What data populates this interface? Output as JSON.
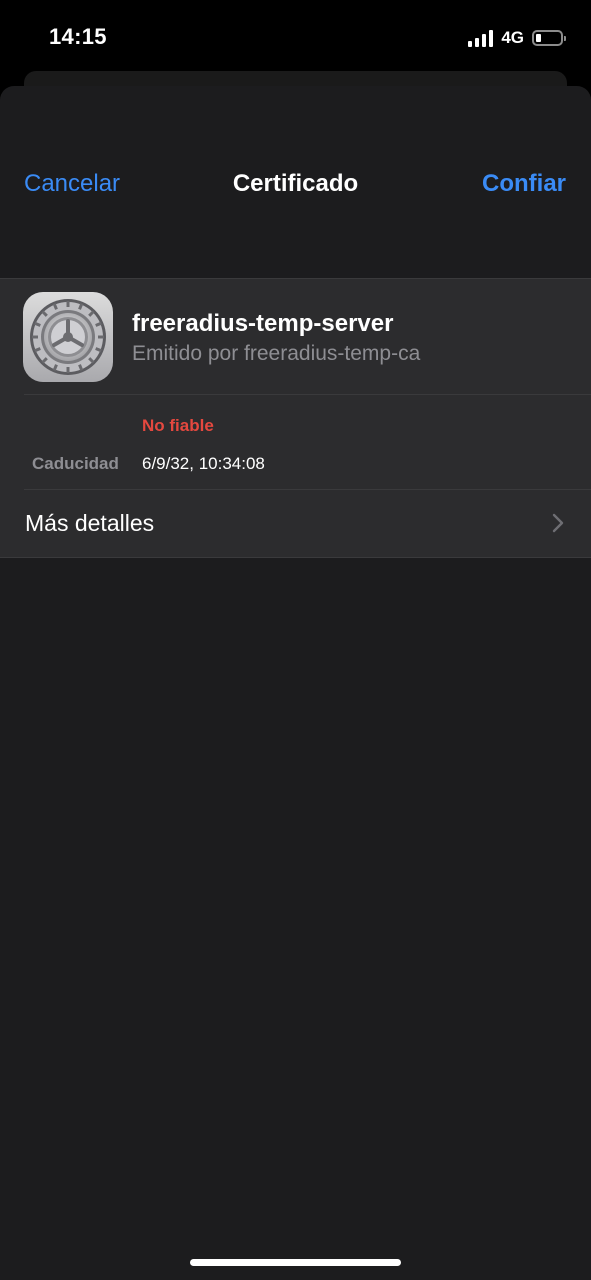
{
  "status_bar": {
    "time": "14:15",
    "network": "4G",
    "battery_level_fraction": 0.2,
    "signal_bars": 4
  },
  "nav": {
    "cancel_label": "Cancelar",
    "title": "Certificado",
    "trust_label": "Confiar"
  },
  "certificate": {
    "icon": "settings-gear-icon",
    "name": "freeradius-temp-server",
    "issuer": "Emitido por freeradius-temp-ca",
    "trust_status": "No fiable",
    "expiry_label": "Caducidad",
    "expiry_value": "6/9/32, 10:34:08"
  },
  "more_details": {
    "label": "Más detalles"
  },
  "colors": {
    "accent": "#3a8bf5",
    "danger": "#e5483f",
    "sheet_background": "#1c1c1e",
    "group_background": "#2c2c2e",
    "secondary_text": "#8e8e93"
  }
}
